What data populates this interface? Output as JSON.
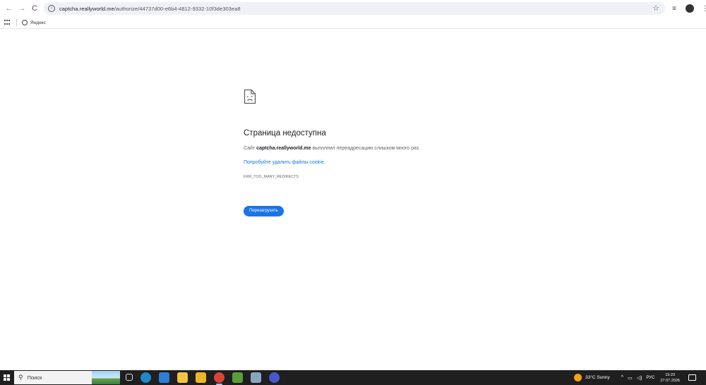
{
  "browser": {
    "url_host": "captcha.reallyworld.me",
    "url_path": "/authorize/44737d00-e6b4-4812-9332-10f3de303ea8",
    "bookmarks": [
      {
        "label": "Яндекс"
      }
    ]
  },
  "error": {
    "title": "Страница недоступна",
    "desc_prefix": "Сайт ",
    "desc_host": "captcha.reallyworld.me",
    "desc_suffix": " выполнил переадресацию слишком много раз.",
    "link": "Попробуйте удалить файлы cookie.",
    "code": "ERR_TOO_MANY_REDIRECTS",
    "reload_label": "Перезагрузить"
  },
  "taskbar": {
    "search_label": "Поиск",
    "weather": "33°C  Sunny",
    "language": "РУС",
    "time": "15:23",
    "date": "27.07.2026",
    "apps": [
      {
        "name": "task-view-icon",
        "color": "#1f1f1f"
      },
      {
        "name": "edge-icon",
        "color": "#1e88c9"
      },
      {
        "name": "store-icon",
        "color": "#2b7fd6"
      },
      {
        "name": "file-explorer-icon",
        "color": "#f5c242"
      },
      {
        "name": "ms-store-bag-icon",
        "color": "#f0b429"
      },
      {
        "name": "chrome-icon",
        "color": "#db4437"
      },
      {
        "name": "minecraft-icon",
        "color": "#5a9e3a"
      },
      {
        "name": "app-window-icon",
        "color": "#8aa4c4"
      },
      {
        "name": "chrome-profile-icon",
        "color": "#4a57c9"
      }
    ]
  }
}
